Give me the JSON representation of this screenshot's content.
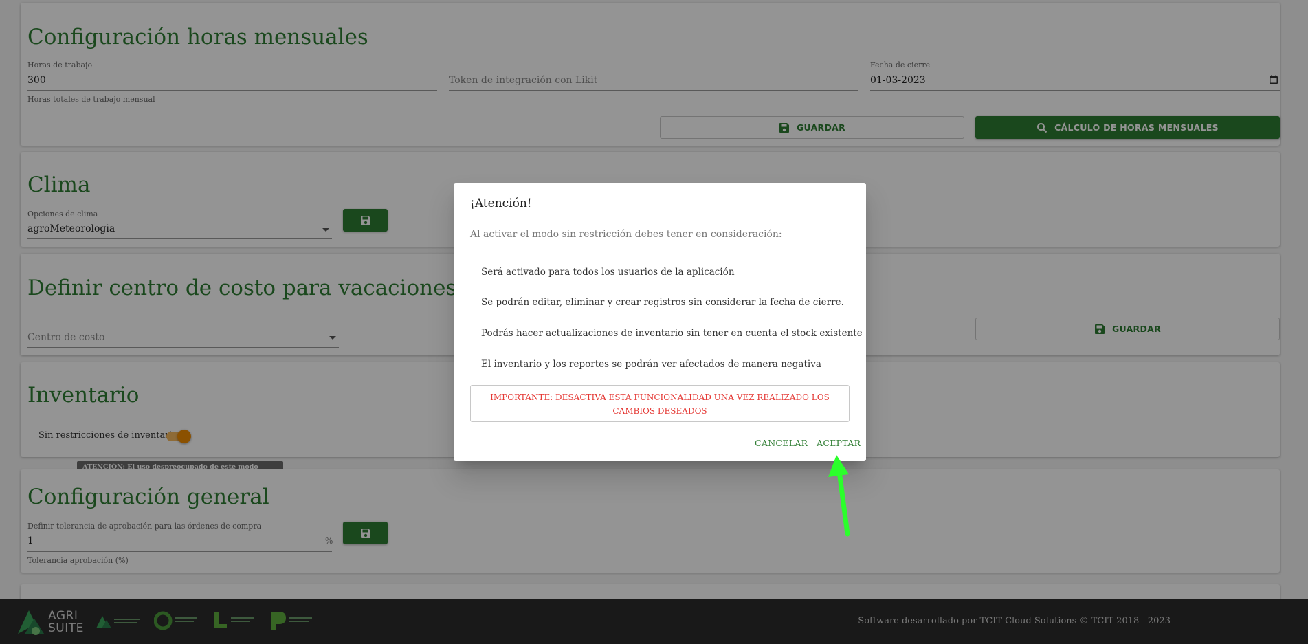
{
  "monthly": {
    "title": "Configuración horas mensuales",
    "hours_label": "Horas de trabajo",
    "hours_value": "300",
    "hours_helper": "Horas totales de trabajo mensual",
    "token_placeholder": "Token de integración con Likit",
    "close_date_label": "Fecha de cierre",
    "close_date_value": "01-03-2023",
    "save_label": "GUARDAR",
    "calc_label": "CÁLCULO DE HORAS MENSUALES"
  },
  "weather": {
    "title": "Clima",
    "options_label": "Opciones de clima",
    "options_value": "agroMeteorologia"
  },
  "vacation": {
    "title": "Definir centro de costo para vacaciones",
    "cost_center_placeholder": "Centro de costo",
    "save_label": "GUARDAR"
  },
  "inventory": {
    "title": "Inventario",
    "toggle_label": "Sin restricciones de inventario",
    "toggle_on": true,
    "tooltip": "ATENCIÓN: El uso despreocupado de este modo puede generar incongruencias de inventario"
  },
  "general": {
    "title": "Configuración general",
    "tolerance_label": "Definir tolerancia de aprobación para las órdenes de compra",
    "tolerance_value": "1",
    "tolerance_suffix": "%",
    "tolerance_helper": "Tolerancia aprobación (%)"
  },
  "footer": {
    "credits": "Software desarrollado por TCIT Cloud Solutions © TCIT 2018 - 2023",
    "brand_top": "AGRI",
    "brand_bottom": "SUITE"
  },
  "dialog": {
    "title": "¡Atención!",
    "subtitle": "Al activar el modo sin restricción debes tener en consideración:",
    "items": [
      "Será activado para todos los usuarios de la aplicación",
      "Se podrán editar, eliminar y crear registros sin considerar la fecha de cierre.",
      "Podrás hacer actualizaciones de inventario sin tener en cuenta el stock existente",
      "El inventario y los reportes se podrán ver afectados de manera negativa"
    ],
    "warning": "IMPORTANTE: DESACTIVA ESTA FUNCIONALIDAD UNA VEZ REALIZADO LOS CAMBIOS DESEADOS",
    "cancel_label": "CANCELAR",
    "accept_label": "ACEPTAR"
  },
  "colors": {
    "brand_green": "#2e7d32",
    "toggle_orange": "#ef8c00",
    "warning_red": "#e53935",
    "annotation_arrow": "#2bff2b"
  }
}
